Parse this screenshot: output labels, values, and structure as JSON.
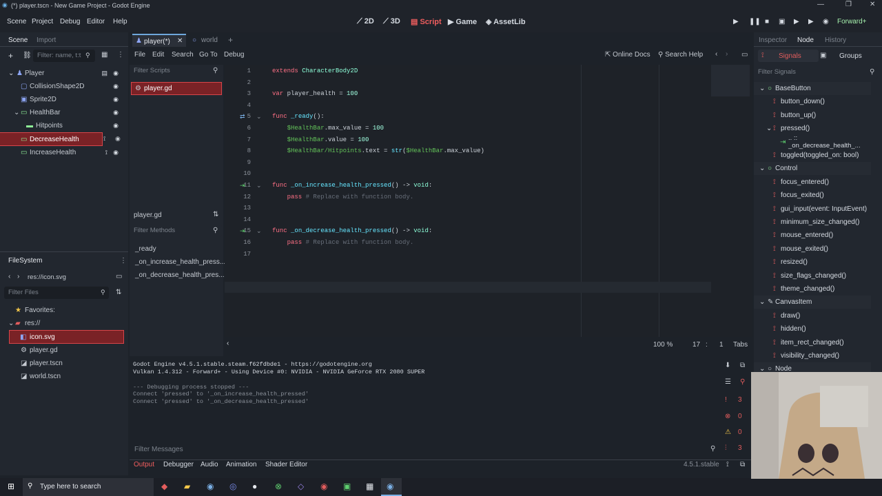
{
  "window": {
    "title": "(*) player.tscn - New Game Project - Godot Engine",
    "controls": [
      "—",
      "❐",
      "✕"
    ]
  },
  "menubar": {
    "menus": [
      "Scene",
      "Project",
      "Debug",
      "Editor",
      "Help"
    ],
    "workspaces": [
      "2D",
      "3D",
      "Script",
      "Game",
      "AssetLib"
    ],
    "active_workspace": "Script",
    "renderer": "Forward+"
  },
  "left_dock": {
    "tabs": [
      "Scene",
      "Import"
    ],
    "filter_placeholder": "Filter: name, t:t",
    "scene_tree": [
      {
        "label": "Player",
        "indent": 0
      },
      {
        "label": "CollisionShape2D",
        "indent": 1
      },
      {
        "label": "Sprite2D",
        "indent": 1
      },
      {
        "label": "HealthBar",
        "indent": 1
      },
      {
        "label": "Hitpoints",
        "indent": 2
      },
      {
        "label": "DecreaseHealth",
        "indent": 1
      },
      {
        "label": "IncreaseHealth",
        "indent": 1
      }
    ],
    "filesystem_title": "FileSystem",
    "path": "res://icon.svg",
    "filter_files_placeholder": "Filter Files",
    "favorites": "Favorites:",
    "files": [
      "res://",
      "icon.svg",
      "player.gd",
      "player.tscn",
      "world.tscn"
    ]
  },
  "center": {
    "tabs": [
      "player(*)",
      "world"
    ],
    "script_menu": [
      "File",
      "Edit",
      "Search",
      "Go To",
      "Debug"
    ],
    "online_docs": "Online Docs",
    "search_help": "Search Help",
    "filter_scripts": "Filter Scripts",
    "scripts": [
      "player.gd"
    ],
    "current_script": "player.gd",
    "filter_methods": "Filter Methods",
    "methods": [
      "_ready",
      "_on_increase_health_press...",
      "_on_decrease_health_pres..."
    ],
    "code_lines": [
      "extends CharacterBody2D",
      "",
      "var player_health = 100",
      "",
      "func _ready():",
      "    $HealthBar.max_value = 100",
      "    $HealthBar.value = 100",
      "    $HealthBar/Hitpoints.text = str($HealthBar.max_value)",
      "",
      "",
      "func _on_increase_health_pressed() -> void:",
      "    pass # Replace with function body.",
      "",
      "",
      "func _on_decrease_health_pressed() -> void:",
      "    pass # Replace with function body.",
      ""
    ],
    "status": {
      "zoom": "100 %",
      "line": "17",
      "col": "1",
      "indent": "Tabs"
    }
  },
  "output": {
    "lines": [
      "Godot Engine v4.5.1.stable.steam.f62fdbde1 - https://godotengine.org",
      "Vulkan 1.4.312 - Forward+ - Using Device #0: NVIDIA - NVIDIA GeForce RTX 2080 SUPER",
      "",
      "--- Debugging process stopped ---",
      "Connect 'pressed' to '_on_increase_health_pressed'",
      "Connect 'pressed' to '_on_decrease_health_pressed'"
    ],
    "filter_placeholder": "Filter Messages",
    "counts": [
      "3",
      "0",
      "0",
      "3"
    ],
    "bottom_tabs": [
      "Output",
      "Debugger",
      "Audio",
      "Animation",
      "Shader Editor"
    ],
    "version": "4.5.1.stable"
  },
  "right_dock": {
    "tabs": [
      "Inspector",
      "Node",
      "History"
    ],
    "subtabs": [
      "Signals",
      "Groups"
    ],
    "filter_placeholder": "Filter Signals",
    "signals": [
      {
        "label": "BaseButton",
        "kind": "class"
      },
      {
        "label": "button_down()",
        "kind": "signal"
      },
      {
        "label": "button_up()",
        "kind": "signal"
      },
      {
        "label": "pressed()",
        "kind": "signal"
      },
      {
        "label": ".. :: _on_decrease_health_...",
        "kind": "conn"
      },
      {
        "label": "toggled(toggled_on: bool)",
        "kind": "signal"
      },
      {
        "label": "Control",
        "kind": "class"
      },
      {
        "label": "focus_entered()",
        "kind": "signal"
      },
      {
        "label": "focus_exited()",
        "kind": "signal"
      },
      {
        "label": "gui_input(event: InputEvent)",
        "kind": "signal"
      },
      {
        "label": "minimum_size_changed()",
        "kind": "signal"
      },
      {
        "label": "mouse_entered()",
        "kind": "signal"
      },
      {
        "label": "mouse_exited()",
        "kind": "signal"
      },
      {
        "label": "resized()",
        "kind": "signal"
      },
      {
        "label": "size_flags_changed()",
        "kind": "signal"
      },
      {
        "label": "theme_changed()",
        "kind": "signal"
      },
      {
        "label": "CanvasItem",
        "kind": "class"
      },
      {
        "label": "draw()",
        "kind": "signal"
      },
      {
        "label": "hidden()",
        "kind": "signal"
      },
      {
        "label": "item_rect_changed()",
        "kind": "signal"
      },
      {
        "label": "visibility_changed()",
        "kind": "signal"
      },
      {
        "label": "Node",
        "kind": "class"
      }
    ]
  },
  "taskbar": {
    "search_placeholder": "Type here to search"
  }
}
